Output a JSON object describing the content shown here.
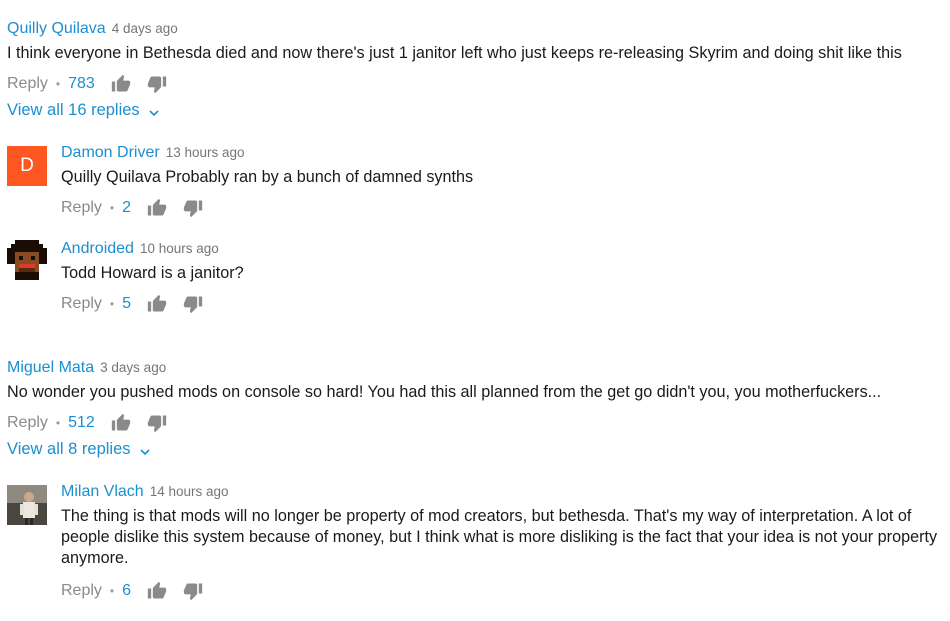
{
  "comments": [
    {
      "author": "Quilly Quilava",
      "time": "4 days ago",
      "text": "I think everyone in Bethesda died and now there's just 1 janitor left who just keeps re-releasing Skyrim and doing shit like this",
      "reply_label": "Reply",
      "likes": "783",
      "view_replies": "View all 16 replies",
      "replies": [
        {
          "author": "Damon Driver",
          "time": "13 hours ago",
          "avatar_letter": "D",
          "text": "Quilly Quilava Probably ran by a bunch of damned synths",
          "reply_label": "Reply",
          "likes": "2"
        },
        {
          "author": "Androided",
          "time": "10 hours ago",
          "text": "Todd Howard is a janitor?",
          "reply_label": "Reply",
          "likes": "5"
        }
      ]
    },
    {
      "author": "Miguel Mata",
      "time": "3 days ago",
      "text": "No wonder you pushed mods on console so hard! You had this all planned from the get go didn't you, you motherfuckers...",
      "reply_label": "Reply",
      "likes": "512",
      "view_replies": "View all 8 replies",
      "replies": [
        {
          "author": "Milan Vlach",
          "time": "14 hours ago",
          "text": "The thing is that mods will no longer be property of mod creators, but bethesda. That's my way of interpretation. A lot of people dislike this system because of money, but I think what is more disliking is the fact that your idea is not your property anymore.",
          "reply_label": "Reply",
          "likes": "6"
        }
      ]
    }
  ],
  "separator": "•",
  "colors": {
    "link": "#1b8fd0",
    "avatar_d": "#ff5722"
  }
}
